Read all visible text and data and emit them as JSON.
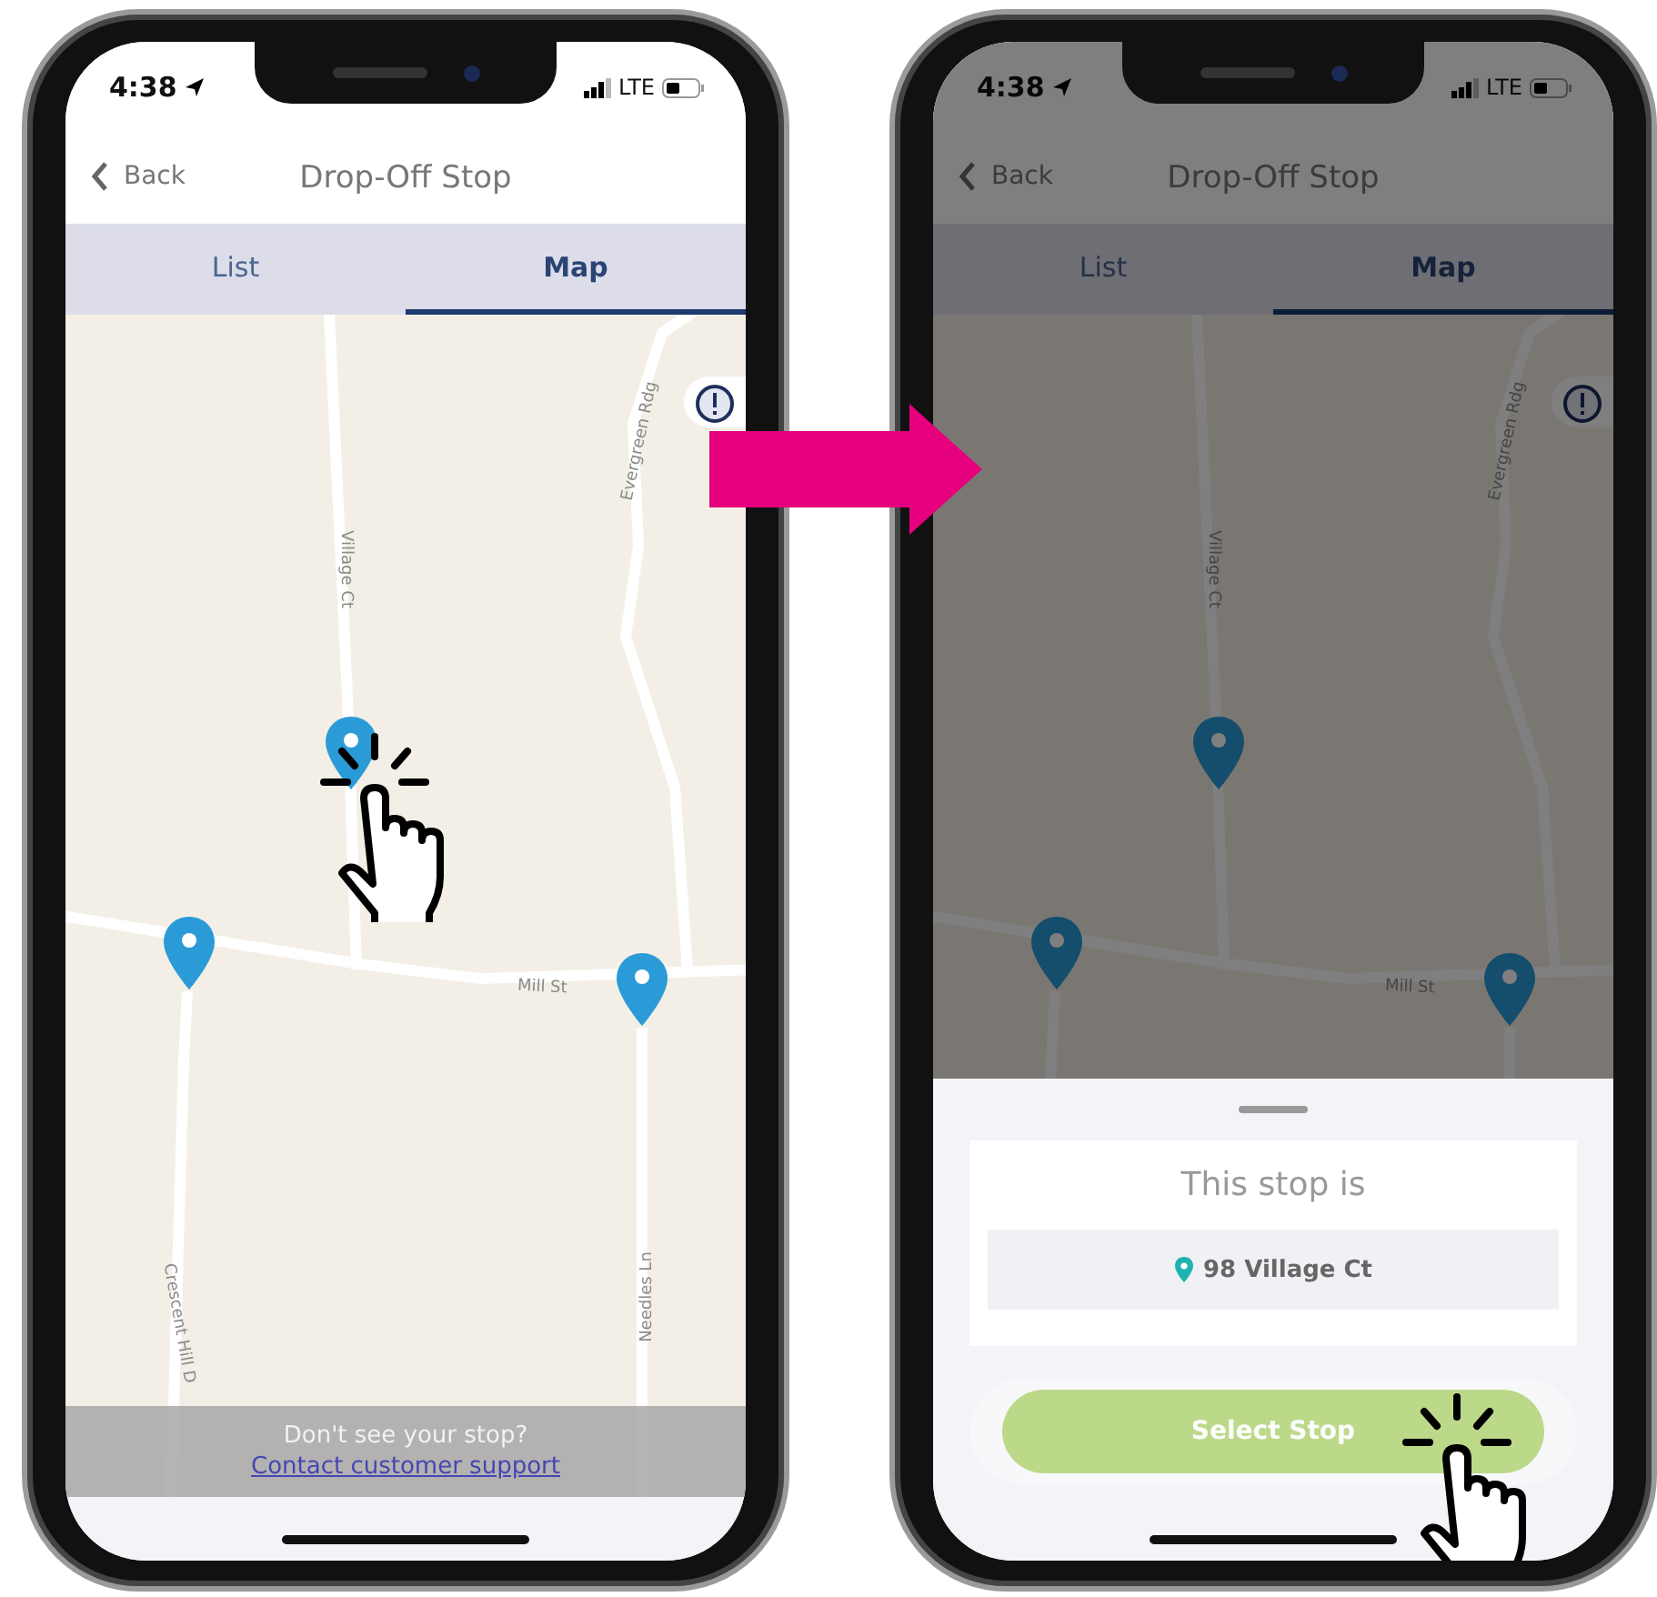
{
  "phones": [
    {
      "status_bar": {
        "time": "4:38",
        "network": "LTE"
      },
      "nav": {
        "back": "Back",
        "title": "Drop-Off Stop"
      },
      "tabs": [
        {
          "label": "List",
          "selected": false
        },
        {
          "label": "Map",
          "selected": true
        }
      ],
      "map": {
        "dimmed": false,
        "streets": [
          "Village Ct",
          "Evergreen Rdg",
          "Mill St",
          "Crescent Hill D",
          "Needles Ln"
        ]
      },
      "footer": {
        "text": "Don't see your stop?",
        "link": "Contact customer support"
      }
    },
    {
      "status_bar": {
        "time": "4:38",
        "network": "LTE"
      },
      "nav": {
        "back": "Back",
        "title": "Drop-Off Stop"
      },
      "tabs": [
        {
          "label": "List",
          "selected": false
        },
        {
          "label": "Map",
          "selected": true
        }
      ],
      "map": {
        "dimmed": true,
        "streets": [
          "Village Ct",
          "Evergreen Rdg",
          "Mill St"
        ]
      },
      "sheet": {
        "heading": "This stop is",
        "address": "98 Village Ct",
        "button": "Select Stop"
      }
    }
  ]
}
